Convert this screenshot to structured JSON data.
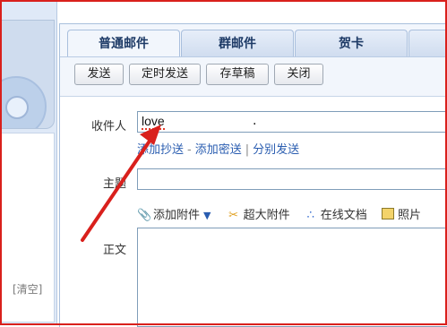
{
  "sidebar": {
    "clear_label": "[清空]"
  },
  "tabs": [
    {
      "label": "普通邮件",
      "active": true
    },
    {
      "label": "群邮件",
      "active": false
    },
    {
      "label": "贺卡",
      "active": false
    },
    {
      "label": "",
      "active": false
    }
  ],
  "toolbar": {
    "send_label": "发送",
    "timed_send_label": "定时发送",
    "save_draft_label": "存草稿",
    "close_label": "关闭"
  },
  "compose": {
    "to_label": "收件人",
    "to_value_visible_start": "love",
    "to_value_visible_end": ".",
    "cc_link": "添加抄送",
    "bcc_link": "添加密送",
    "separate_send_link": "分别发送",
    "link_separator_dash": "-",
    "link_separator_pipe": "|",
    "subject_label": "主题",
    "subject_value": "",
    "body_label": "正文",
    "body_value": ""
  },
  "attachments": {
    "add_attachment": "添加附件",
    "large_attachment": "超大附件",
    "online_doc": "在线文档",
    "photo": "照片"
  },
  "colors": {
    "annotation_red": "#d9201c",
    "link_blue": "#2a5db0",
    "tab_text": "#1d3a66"
  }
}
